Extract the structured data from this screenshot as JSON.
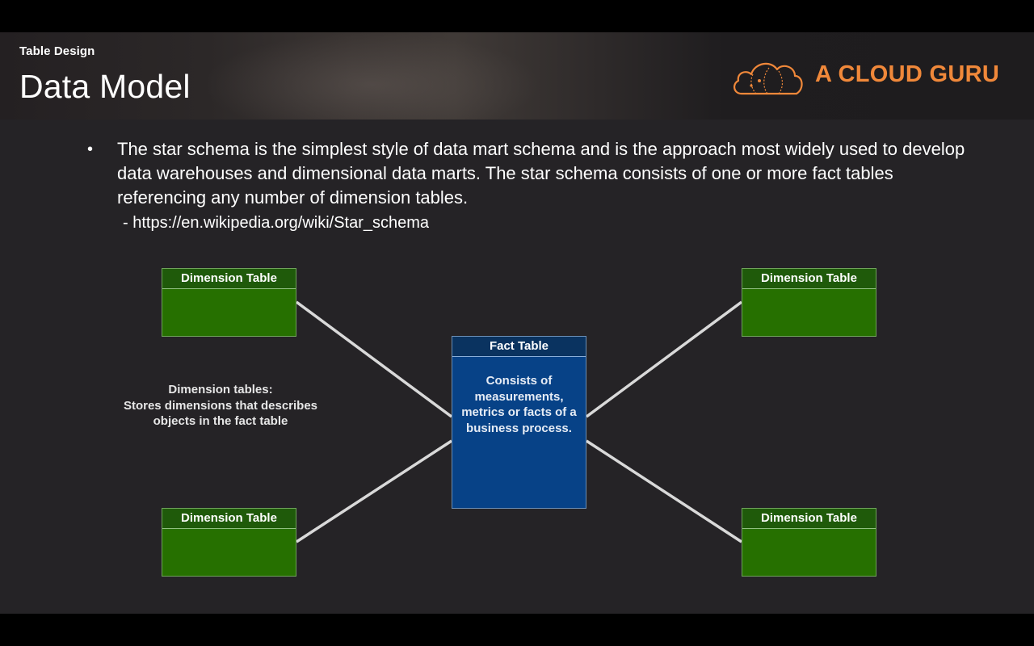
{
  "header": {
    "section_label": "Table Design",
    "title": "Data Model",
    "logo_text": "A CLOUD GURU",
    "logo_icon": "cloud-icon",
    "accent_color": "#f0883a"
  },
  "content": {
    "bullet_symbol": "•",
    "bullet_text": "The star schema is the simplest style of data mart schema and is the approach most widely used to develop data warehouses and dimensional data marts. The star schema consists of one or more fact tables referencing any number of dimension tables.",
    "source": "- https://en.wikipedia.org/wiki/Star_schema"
  },
  "diagram": {
    "dimension_tables": [
      {
        "label": "Dimension Table"
      },
      {
        "label": "Dimension Table"
      },
      {
        "label": "Dimension Table"
      },
      {
        "label": "Dimension Table"
      }
    ],
    "fact_table": {
      "label": "Fact Table",
      "body_lines": [
        "Consists of",
        "measurements,",
        "metrics or facts of a",
        "business process."
      ]
    },
    "dimension_note": {
      "lines": [
        "Dimension tables:",
        "Stores dimensions that describes",
        "objects in the fact table"
      ]
    },
    "colors": {
      "dimension_fill": "#267000",
      "fact_fill": "#074287",
      "connector": "#d9d9d9"
    }
  }
}
